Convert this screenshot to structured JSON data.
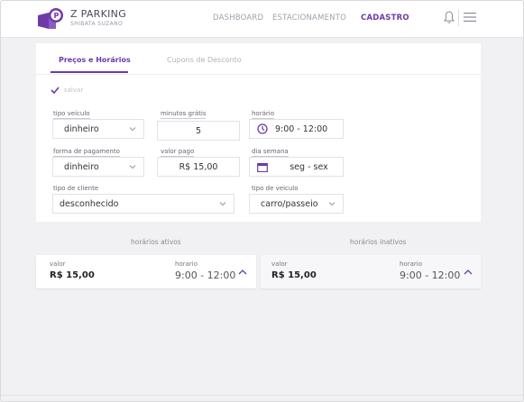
{
  "app": {
    "name": "Z PARKING",
    "user": "SHIBATA SUZANO"
  },
  "nav": {
    "dashboard": "DASHBOARD",
    "estacionamento": "ESTACIONAMENTO",
    "cadastro": "CADASTRO"
  },
  "tabs": {
    "precos": "Preços e Horários",
    "cupons": "Cupons de Desconto"
  },
  "form": {
    "save_label": "salvar",
    "tipo_veiculo": {
      "label": "tipo veículo",
      "value": "dinheiro"
    },
    "minutos_gratis": {
      "label": "minutos grátis",
      "value": "5"
    },
    "horario": {
      "label": "horário",
      "value": "9:00 - 12:00"
    },
    "forma_pagamento": {
      "label": "forma de pagamento",
      "value": "dinheiro"
    },
    "valor_pago": {
      "label": "valor pago",
      "value": "R$ 15,00"
    },
    "dia_semana": {
      "label": "dia semana",
      "value": "seg - sex"
    },
    "tipo_cliente": {
      "label": "tipo de cliente",
      "value": "desconhecido"
    },
    "tipo_veiculo2": {
      "label": "tipo de veiculo",
      "value": "carro/passeio"
    }
  },
  "sections": {
    "ativos": "horários ativos",
    "inativos": "horários inativos"
  },
  "cards": {
    "active": {
      "valor_label": "valor",
      "valor": "R$ 15,00",
      "horario_label": "horario",
      "horario": "9:00 - 12:00"
    },
    "inactive": {
      "valor_label": "valor",
      "valor": "R$ 15,00",
      "horario_label": "horario",
      "horario": "9:00 - 12:00"
    }
  },
  "colors": {
    "accent": "#6e3aa6",
    "background": "#f1f1f3"
  }
}
